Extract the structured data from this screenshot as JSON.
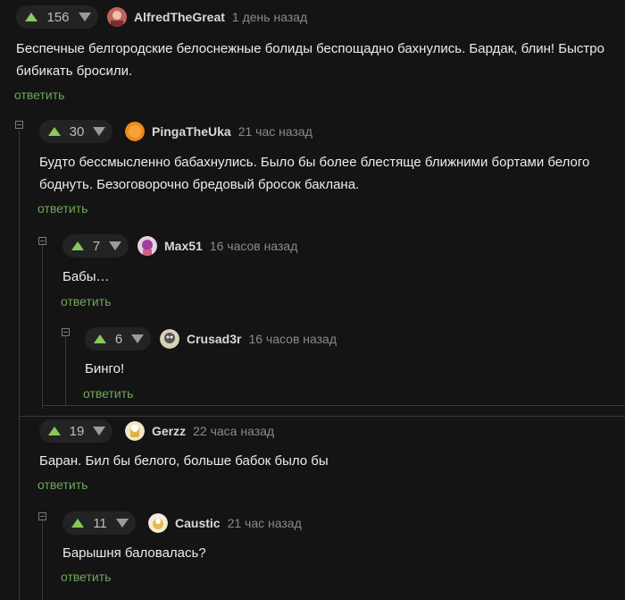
{
  "colors": {
    "background": "#141414",
    "accent_green": "#8ac858",
    "reply_green": "#6fa75a"
  },
  "comments": [
    {
      "score": "156",
      "author": "AlfredTheGreat",
      "time": "1 день назад",
      "text": "Беспечные белгородские белоснежные болиды беспощадно бахнулись. Бардак, блин! Быстро бибикать бросили.",
      "reply": "ответить"
    },
    {
      "score": "30",
      "author": "PingaTheUka",
      "time": "21 час назад",
      "text": "Будто бессмысленно бабахнулись. Было бы более блестяще ближними бортами белого боднуть. Безоговорочно бредовый бросок баклана.",
      "reply": "ответить"
    },
    {
      "score": "7",
      "author": "Max51",
      "time": "16 часов назад",
      "text": "Бабы…",
      "reply": "ответить"
    },
    {
      "score": "6",
      "author": "Crusad3r",
      "time": "16 часов назад",
      "text": "Бинго!",
      "reply": "ответить"
    },
    {
      "score": "19",
      "author": "Gerzz",
      "time": "22 часа назад",
      "text": "Баран. Бил бы белого, больше бабок было бы",
      "reply": "ответить"
    },
    {
      "score": "11",
      "author": "Caustic",
      "time": "21 час назад",
      "text": "Барышня баловалась?",
      "reply": "ответить"
    }
  ]
}
